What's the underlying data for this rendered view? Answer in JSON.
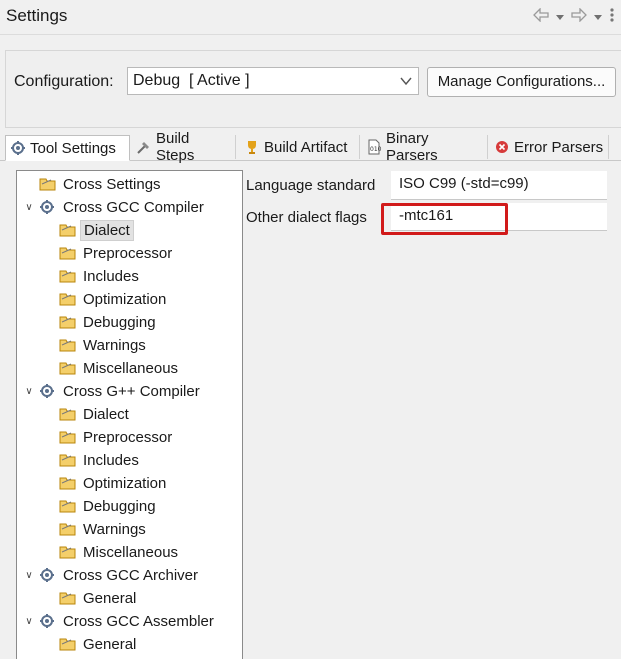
{
  "header": {
    "title": "Settings"
  },
  "configuration": {
    "label": "Configuration:",
    "selected": "Debug  [ Active ]",
    "manage_label": "Manage Configurations..."
  },
  "tabs": [
    {
      "label": "Tool Settings",
      "icon": "tool-settings-icon",
      "active": true
    },
    {
      "label": "Build Steps",
      "icon": "build-steps-icon"
    },
    {
      "label": "Build Artifact",
      "icon": "build-artifact-icon"
    },
    {
      "label": "Binary Parsers",
      "icon": "binary-parsers-icon"
    },
    {
      "label": "Error Parsers",
      "icon": "error-parsers-icon"
    }
  ],
  "tree": [
    {
      "label": "Cross Settings",
      "icon": "folder-icon"
    },
    {
      "label": "Cross GCC Compiler",
      "icon": "gear-icon",
      "expanded": true
    },
    {
      "label": "Dialect",
      "icon": "folder-icon",
      "selected": true
    },
    {
      "label": "Preprocessor",
      "icon": "folder-icon"
    },
    {
      "label": "Includes",
      "icon": "folder-icon"
    },
    {
      "label": "Optimization",
      "icon": "folder-icon"
    },
    {
      "label": "Debugging",
      "icon": "folder-icon"
    },
    {
      "label": "Warnings",
      "icon": "folder-icon"
    },
    {
      "label": "Miscellaneous",
      "icon": "folder-icon"
    },
    {
      "label": "Cross G++ Compiler",
      "icon": "gear-icon",
      "expanded": true
    },
    {
      "label": "Dialect",
      "icon": "folder-icon"
    },
    {
      "label": "Preprocessor",
      "icon": "folder-icon"
    },
    {
      "label": "Includes",
      "icon": "folder-icon"
    },
    {
      "label": "Optimization",
      "icon": "folder-icon"
    },
    {
      "label": "Debugging",
      "icon": "folder-icon"
    },
    {
      "label": "Warnings",
      "icon": "folder-icon"
    },
    {
      "label": "Miscellaneous",
      "icon": "folder-icon"
    },
    {
      "label": "Cross GCC Archiver",
      "icon": "gear-icon",
      "expanded": true
    },
    {
      "label": "General",
      "icon": "folder-icon"
    },
    {
      "label": "Cross GCC Assembler",
      "icon": "gear-icon",
      "expanded": true
    },
    {
      "label": "General",
      "icon": "folder-icon"
    }
  ],
  "form": {
    "language_standard_label": "Language standard",
    "language_standard_value": "ISO C99 (-std=c99)",
    "other_flags_label": "Other dialect flags",
    "other_flags_value": "-mtc161"
  },
  "colors": {
    "highlight": "#d11a1a",
    "folder": "#e8b64a",
    "gear": "#5a6f8c"
  }
}
